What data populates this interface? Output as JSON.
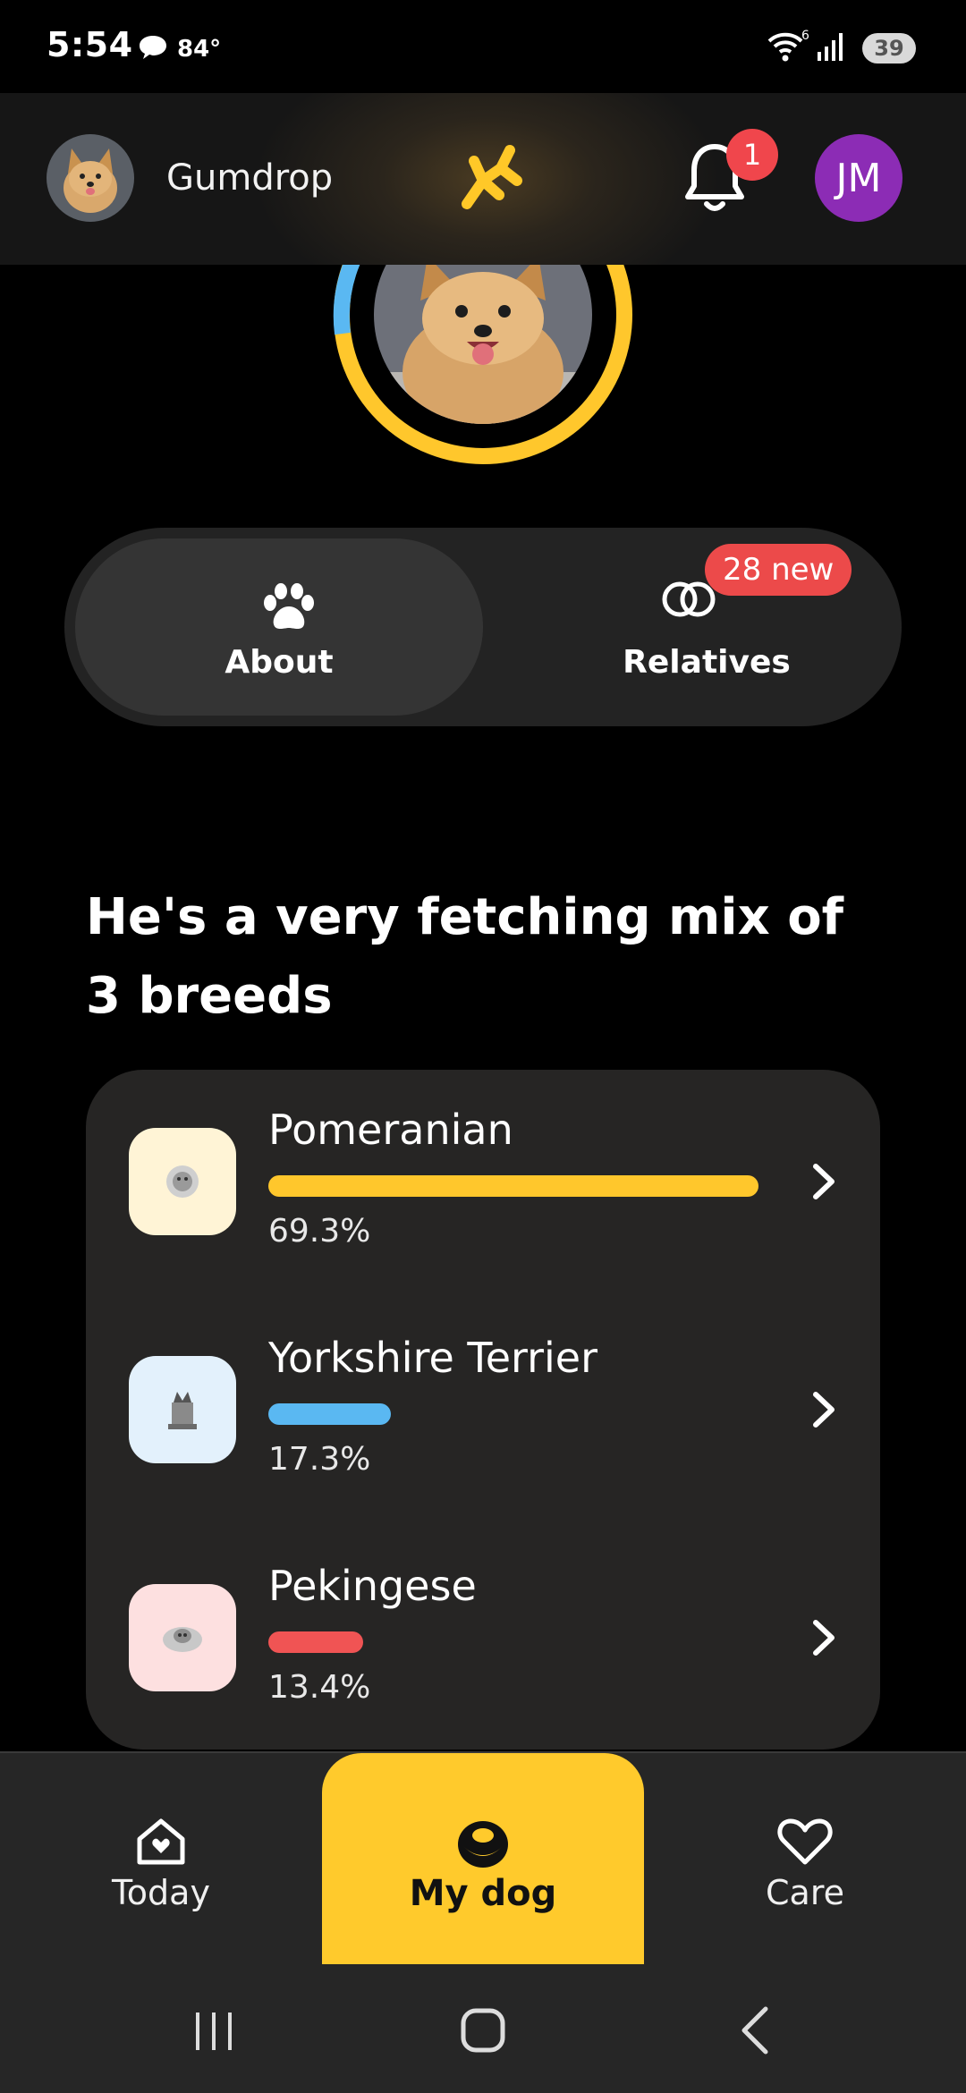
{
  "status_bar": {
    "time": "5:54",
    "temperature": "84°",
    "wifi_label": "6",
    "battery": "39"
  },
  "header": {
    "dog_name": "Gumdrop",
    "notification_count": "1",
    "user_initials": "JM",
    "logo_icon": "balloon-dog-logo-icon",
    "colors": {
      "logo": "#ffc828",
      "badge": "#f0464c",
      "avatar": "#8c2cb5"
    }
  },
  "tabs": {
    "about_label": "About",
    "relatives_label": "Relatives",
    "relatives_badge": "28 new"
  },
  "heading": "He's a very fetching mix of 3 breeds",
  "breeds": [
    {
      "name": "Pomeranian",
      "percent": "69.3%",
      "fraction": 0.693,
      "color": "#ffc72c",
      "thumb_bg": "#fff4d6"
    },
    {
      "name": "Yorkshire Terrier",
      "percent": "17.3%",
      "fraction": 0.173,
      "color": "#5ab8f2",
      "thumb_bg": "#e3f1fc"
    },
    {
      "name": "Pekingese",
      "percent": "13.4%",
      "fraction": 0.134,
      "color": "#f05454",
      "thumb_bg": "#fde0e0"
    }
  ],
  "bottom_nav": {
    "today": "Today",
    "my_dog": "My dog",
    "care": "Care",
    "active": "my_dog",
    "active_color": "#ffca2c"
  }
}
